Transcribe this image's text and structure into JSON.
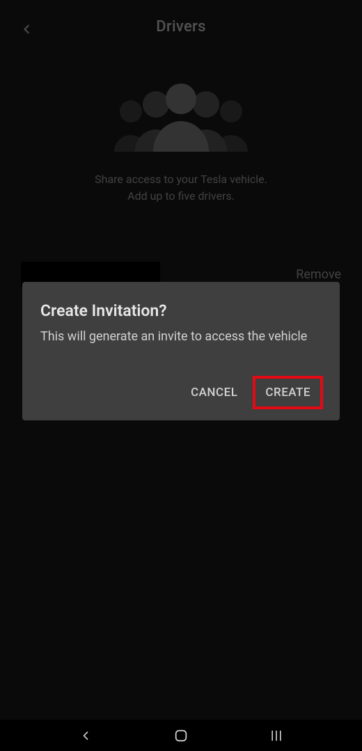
{
  "header": {
    "title": "Drivers"
  },
  "description": {
    "line1": "Share access to your Tesla vehicle.",
    "line2": "Add up to five drivers."
  },
  "driver_row": {
    "remove_label": "Remove"
  },
  "dialog": {
    "title": "Create Invitation?",
    "body": "This will generate an invite to access the vehicle",
    "cancel_label": "CANCEL",
    "create_label": "CREATE"
  }
}
